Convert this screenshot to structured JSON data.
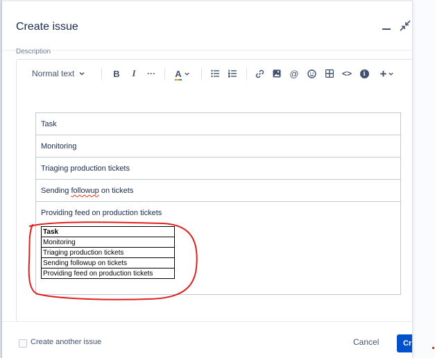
{
  "modal": {
    "title": "Create issue",
    "description_label": "Description"
  },
  "toolbar": {
    "text_style": "Normal text",
    "buttons": [
      "bold-icon",
      "italic-icon",
      "more-formatting-icon",
      "text-color-icon",
      "bullet-list-icon",
      "numbered-list-icon",
      "link-icon",
      "image-icon",
      "mention-icon",
      "emoji-icon",
      "table-icon",
      "code-icon",
      "info-icon",
      "insert-plus-icon"
    ],
    "bold": "B",
    "italic": "I",
    "more": "···",
    "text_color": "A",
    "mention": "@",
    "code": "<>",
    "info": "i",
    "insert": "+"
  },
  "editor_table": {
    "rows": [
      "Task",
      "Monitoring",
      "Triaging production tickets",
      "Sending followup on tickets",
      "Providing feed on production tickets"
    ],
    "row4_parts": [
      "Sending ",
      "followup",
      " on tickets"
    ]
  },
  "pasted_table": {
    "header": "Task",
    "rows": [
      "Monitoring",
      "Triaging production tickets",
      "Sending followup on tickets",
      "Providing feed on production tickets"
    ]
  },
  "footer": {
    "create_another_label": "Create another issue",
    "create_another_checked": false,
    "cancel_label": "Cancel",
    "create_label_partial": "Cr"
  },
  "colors": {
    "primary": "#0052cc",
    "annotation": "#e01e1e",
    "spellcheck": "#de350b"
  }
}
